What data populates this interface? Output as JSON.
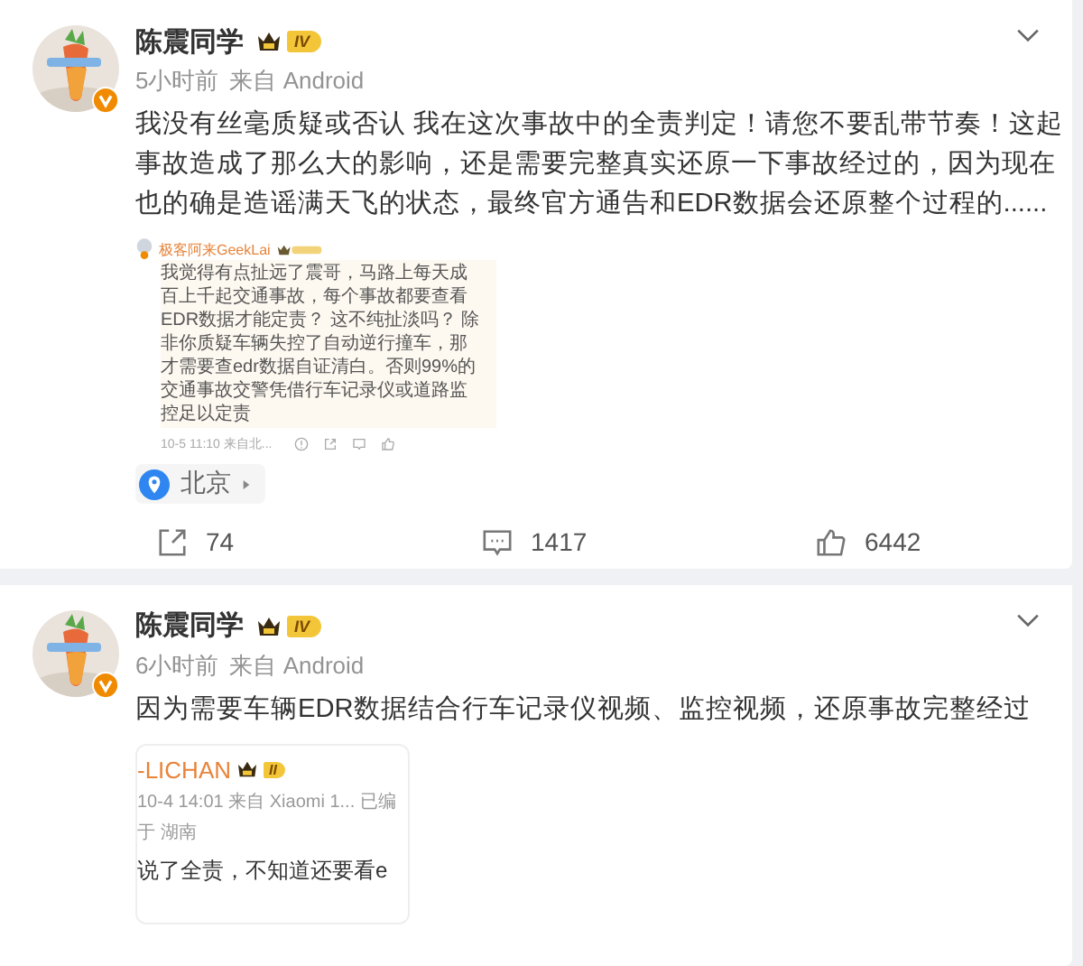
{
  "posts": [
    {
      "author": "陈震同学",
      "level": "IV",
      "time": "5小时前",
      "source": "来自 Android",
      "text": "我没有丝毫质疑或否认 我在这次事故中的全责判定！请您不要乱带节奏！这起事故造成了那么大的影响，还是需要完整真实还原一下事故经过的，因为现在也的确是造谣满天飞的状态，最终官方通告和EDR数据会还原整个过程的......",
      "embed": {
        "kind": "comment",
        "author": "极客阿来GeekLai",
        "lines": [
          "我觉得有点扯远了震哥，马路上每天成",
          "百上千起交通事故，每个事故都要查看",
          "EDR数据才能定责？ 这不纯扯淡吗？ 除",
          "非你质疑车辆失控了自动逆行撞车，那",
          "才需要查edr数据自证清白。否则99%的",
          "交通事故交警凭借行车记录仪或道路监",
          "控足以定责"
        ],
        "meta": [
          "10-5 11:10 来自北..."
        ]
      },
      "location": "北京",
      "reposts": "74",
      "comments": "1417",
      "likes": "6442"
    },
    {
      "author": "陈震同学",
      "level": "IV",
      "time": "6小时前",
      "source": "来自 Android",
      "text": "因为需要车辆EDR数据结合行车记录仪视频、监控视频，还原事故完整经过",
      "embed": {
        "kind": "post",
        "author": "-LICHAN",
        "level": "II",
        "meta": [
          "10-4 14:01  来自 Xiaomi 1...  已编",
          "于 湖南"
        ],
        "lines": [
          "说了全责，不知道还要看e"
        ]
      }
    }
  ]
}
